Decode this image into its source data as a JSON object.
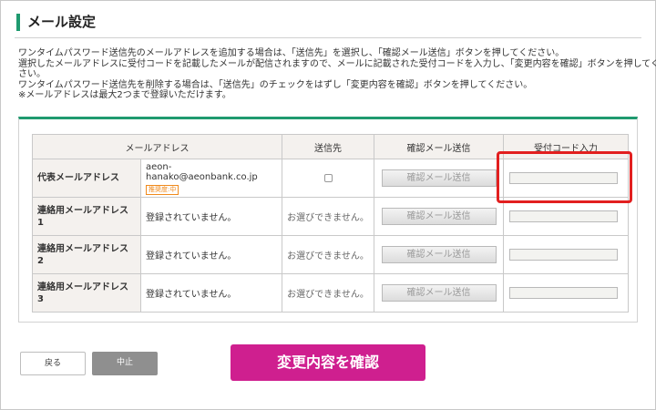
{
  "header": {
    "title": "メール設定"
  },
  "description": {
    "lines": [
      "ワンタイムパスワード送信先のメールアドレスを追加する場合は、「送信先」を選択し、「確認メール送信」ボタンを押してください。",
      "選択したメールアドレスに受付コードを記載したメールが配信されますので、メールに記載された受付コードを入力し、「変更内容を確認」ボタンを押してくだ",
      "さい。",
      "ワンタイムパスワード送信先を削除する場合は、「送信先」のチェックをはずし「変更内容を確認」ボタンを押してください。",
      "※メールアドレスは最大2つまで登録いただけます。"
    ]
  },
  "table": {
    "headers": {
      "email": "メールアドレス",
      "destination": "送信先",
      "send": "確認メール送信",
      "code": "受付コード入力"
    },
    "rows": [
      {
        "label": "代表メールアドレス",
        "email": "aeon-hanako@aeonbank.co.jp",
        "badge": "推奨度:中",
        "destination": "",
        "send_label": "確認メール送信"
      },
      {
        "label": "連絡用メールアドレス1",
        "email": "登録されていません。",
        "destination": "お選びできません。",
        "send_label": "確認メール送信"
      },
      {
        "label": "連絡用メールアドレス2",
        "email": "登録されていません。",
        "destination": "お選びできません。",
        "send_label": "確認メール送信"
      },
      {
        "label": "連絡用メールアドレス3",
        "email": "登録されていません。",
        "destination": "お選びできません。",
        "send_label": "確認メール送信"
      }
    ]
  },
  "buttons": {
    "back": "戻る",
    "stop": "中止",
    "confirm": "変更内容を確認"
  },
  "colors": {
    "accent_green": "#1f9a6f",
    "confirm_magenta": "#cf1f8f",
    "highlight_red": "#e21f1f",
    "badge_orange": "#f08a1c"
  }
}
